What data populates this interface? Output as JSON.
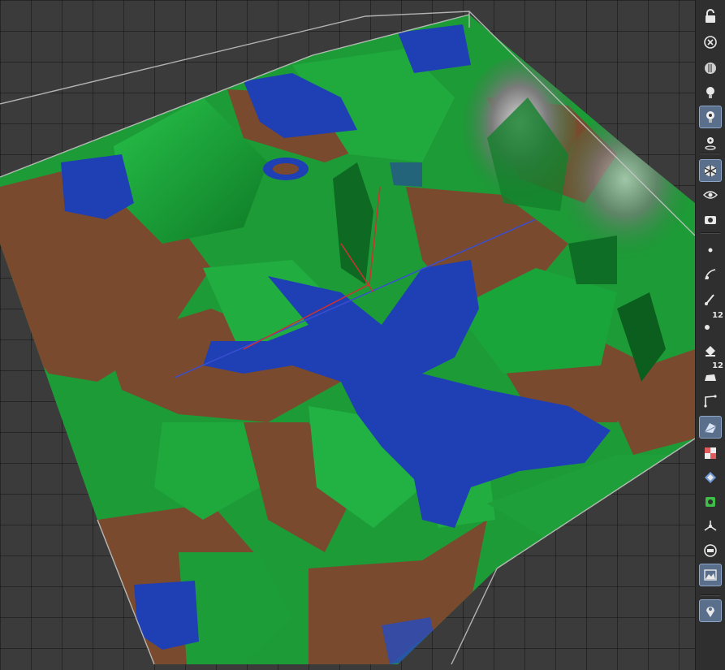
{
  "viewport": {
    "corner_readout": "",
    "colors": {
      "background": "#3b3b3b",
      "grid": "#262626",
      "water": "#1f3fb5",
      "land_low": "#7a4a2e",
      "land_high": "#1fa83a",
      "peak": "#9a9a9a",
      "bounding_box": "#c8c8c8"
    }
  },
  "toolbar": {
    "buttons": [
      {
        "name": "lock-icon",
        "icon": "lock",
        "active": false
      },
      {
        "name": "close-circle-icon",
        "icon": "close-circle",
        "active": false
      },
      {
        "name": "light-sphere-icon",
        "icon": "sphere-light",
        "active": false
      },
      {
        "name": "bulb-icon",
        "icon": "bulb",
        "active": false
      },
      {
        "name": "bulb-camera-icon",
        "icon": "bulb-cam",
        "active": true
      },
      {
        "name": "bulb-target-icon",
        "icon": "bulb-target",
        "active": false
      },
      {
        "name": "cube-view-icon",
        "icon": "cube",
        "active": true
      },
      {
        "name": "eye-view-icon",
        "icon": "eye",
        "active": false
      },
      {
        "name": "camera-eye-icon",
        "icon": "camera-eye",
        "active": false
      },
      {
        "name": "point-icon",
        "icon": "point",
        "active": false
      },
      {
        "name": "curve-point-icon",
        "icon": "curve",
        "active": false
      },
      {
        "name": "brush-icon",
        "icon": "brush",
        "active": false
      },
      {
        "name": "point-count-icon",
        "icon": "point-count",
        "active": false,
        "badge": "12"
      },
      {
        "name": "paint-bucket-icon",
        "icon": "bucket",
        "active": false
      },
      {
        "name": "face-count-icon",
        "icon": "face-count",
        "active": false,
        "badge": "12"
      },
      {
        "name": "corner-angle-icon",
        "icon": "corner",
        "active": false
      },
      {
        "name": "shaded-plane-icon",
        "icon": "plane",
        "active": true
      },
      {
        "name": "checker-texture-icon",
        "icon": "checker",
        "active": false
      },
      {
        "name": "diamond-layer-icon",
        "icon": "diamond",
        "active": false
      },
      {
        "name": "green-gear-icon",
        "icon": "gear",
        "active": false
      },
      {
        "name": "axis-gizmo-icon",
        "icon": "axis",
        "active": false
      },
      {
        "name": "circle-stop-icon",
        "icon": "circle",
        "active": false
      },
      {
        "name": "landscape-image-icon",
        "icon": "landscape",
        "active": true
      },
      {
        "name": "location-pin-icon",
        "icon": "pin",
        "active": true
      }
    ]
  }
}
